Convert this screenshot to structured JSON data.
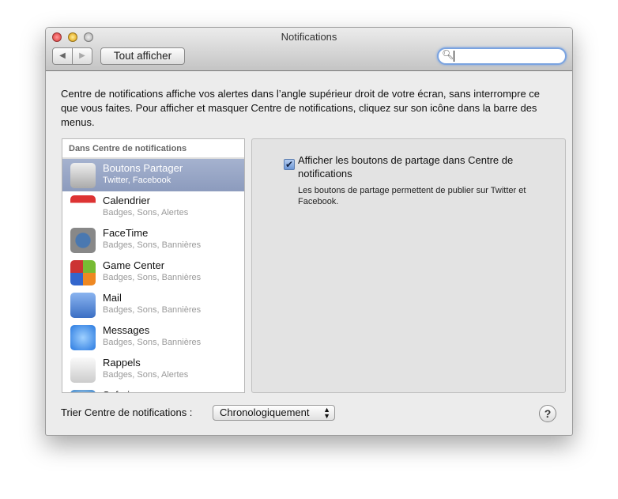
{
  "window": {
    "title": "Notifications",
    "show_all": "Tout afficher",
    "search_value": ""
  },
  "intro": "Centre de notifications affiche vos alertes dans l’angle supérieur droit de votre écran, sans interrompre ce que vous faites. Pour afficher et masquer Centre de notifications, cliquez sur son icône dans la barre des menus.",
  "list": {
    "header": "Dans Centre de notifications",
    "items": [
      {
        "name": "Boutons Partager",
        "sub": "Twitter, Facebook",
        "icon": "share-icon",
        "selected": true
      },
      {
        "name": "Calendrier",
        "sub": "Badges, Sons, Alertes",
        "icon": "calendar-icon"
      },
      {
        "name": "FaceTime",
        "sub": "Badges, Sons, Bannières",
        "icon": "facetime-icon"
      },
      {
        "name": "Game Center",
        "sub": "Badges, Sons, Bannières",
        "icon": "game-center-icon"
      },
      {
        "name": "Mail",
        "sub": "Badges, Sons, Bannières",
        "icon": "mail-icon"
      },
      {
        "name": "Messages",
        "sub": "Badges, Sons, Bannières",
        "icon": "messages-icon"
      },
      {
        "name": "Rappels",
        "sub": "Badges, Sons, Alertes",
        "icon": "reminders-icon"
      },
      {
        "name": "Safari",
        "sub": "",
        "icon": "safari-icon"
      }
    ]
  },
  "panel": {
    "checkbox_label": "Afficher les boutons de partage dans Centre de notifications",
    "checked": true,
    "description": "Les boutons de partage permettent de publier sur Twitter et Facebook."
  },
  "sort": {
    "label": "Trier Centre de notifications :",
    "value": "Chronologiquement"
  },
  "help": "?"
}
